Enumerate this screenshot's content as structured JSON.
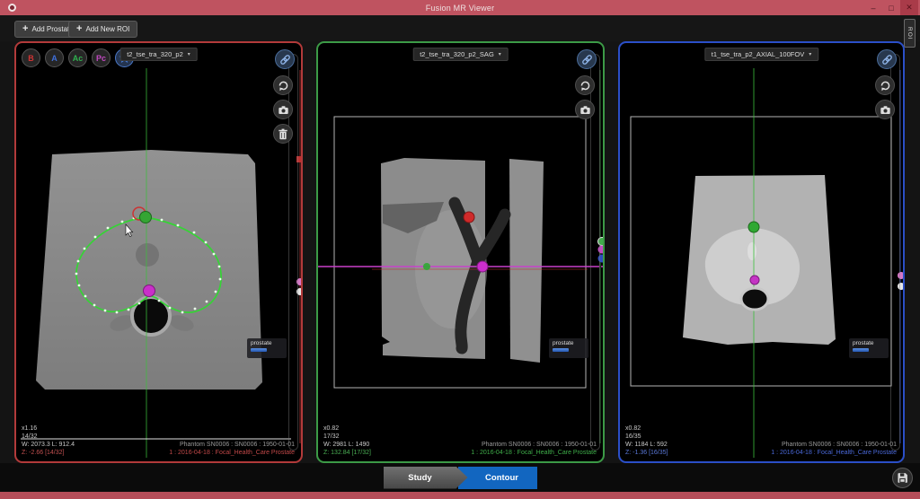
{
  "window": {
    "title": "Fusion MR Viewer"
  },
  "glyphs": {
    "plus": "+",
    "chevron_down": "▾",
    "minimize": "–",
    "maximize": "□",
    "close": "✕"
  },
  "toolbar": {
    "add_prostate_label": "Add Prostate",
    "add_new_roi_label": "Add New ROI",
    "side_tab_label": "ROI"
  },
  "roi_tools": [
    {
      "label": "B",
      "color": "#d03434"
    },
    {
      "label": "A",
      "color": "#3f6fd8"
    },
    {
      "label": "Ac",
      "color": "#2fae4e"
    },
    {
      "label": "Pc",
      "color": "#c24ac2"
    },
    {
      "label": "star",
      "color": "#4a78c8"
    }
  ],
  "viewports": [
    {
      "series": "t2_tse_tra_320_p2",
      "accent": "#b23a3a",
      "scale": "x1.16",
      "slice": "14/32",
      "window_level": "W: 2073.3 L: 912.4",
      "z_position": "Z: -2.66 [14/32]",
      "patient": "Phantom SN0006 : SN0006 : 1950-01-01",
      "study": "1 : 2016-04-18 : Focal_Health_Care Prostate",
      "roi_label": "prostate"
    },
    {
      "series": "t2_tse_tra_320_p2_SAG",
      "accent": "#3c9a46",
      "scale": "x0.82",
      "slice": "17/32",
      "window_level": "W: 2981 L: 1490",
      "z_position": "Z: 132.84 [17/32]",
      "patient": "Phantom SN0006 : SN0006 : 1950-01-01",
      "study": "1 : 2016-04-18 : Focal_Health_Care Prostate",
      "roi_label": "prostate"
    },
    {
      "series": "t1_tse_tra_p2_AXIAL_100FOV",
      "accent": "#2b4fc8",
      "scale": "x0.82",
      "slice": "16/35",
      "window_level": "W: 1184 L: 592",
      "z_position": "Z: -1.36 [16/35]",
      "patient": "Phantom SN0006 : SN0006 : 1950-01-01",
      "study": "1 : 2016-04-18 : Focal_Health_Care Prostate",
      "roi_label": "prostate"
    }
  ],
  "footer": {
    "steps": [
      {
        "label": "Study"
      },
      {
        "label": "Contour",
        "active": true
      }
    ]
  },
  "icons": {
    "app-icon": "circle-logo",
    "link-icon": "chain",
    "refresh-icon": "circular-arrows",
    "camera-icon": "camera",
    "trash-icon": "trash-can",
    "star-tool-icon": "five-point-star",
    "save-icon": "floppy-disk",
    "cursor-icon": "mouse-arrow"
  }
}
